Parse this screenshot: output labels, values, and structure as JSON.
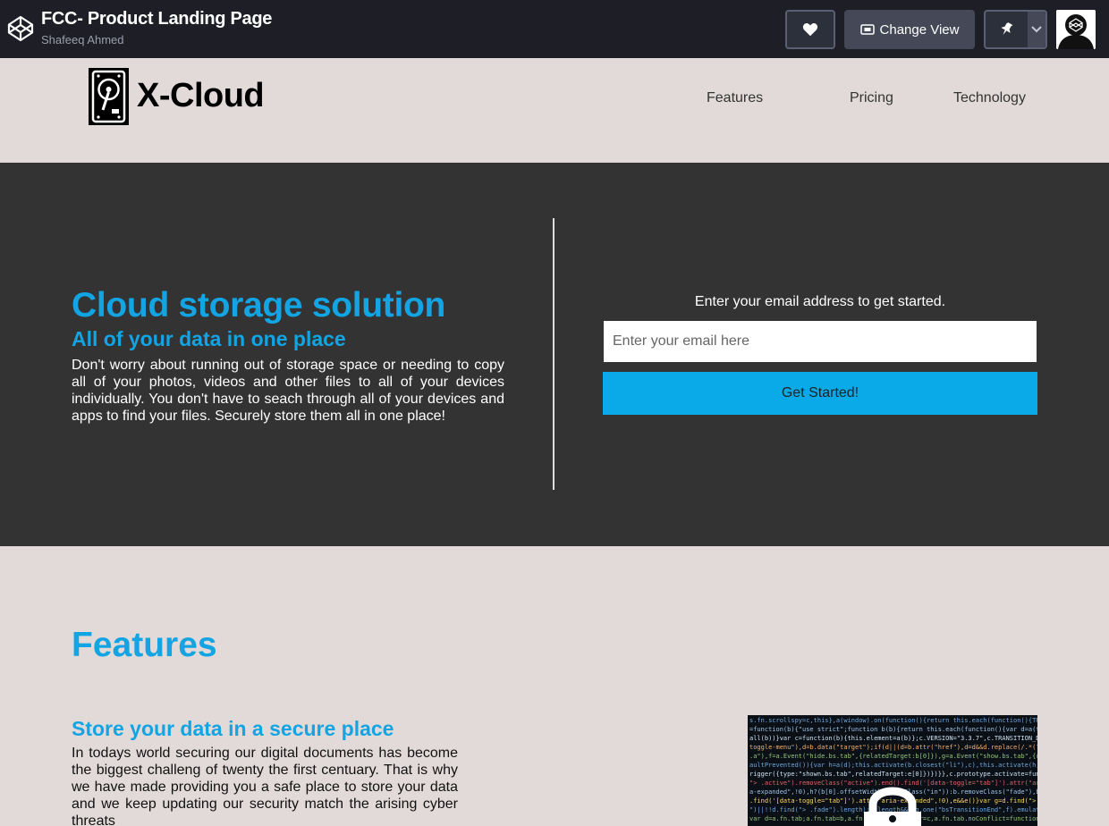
{
  "codepen": {
    "title": "FCC- Product Landing Page",
    "author": "Shafeeq Ahmed",
    "change_view_label": "Change View"
  },
  "site": {
    "brand": "X-Cloud",
    "nav": [
      {
        "label": "Features"
      },
      {
        "label": "Pricing"
      },
      {
        "label": "Technology"
      }
    ]
  },
  "hero": {
    "title": "Cloud storage solution",
    "subtitle": "All of your data in one place",
    "text": "Don't worry about running out of storage space or needing to copy all of your photos, videos and other files to all of your devices individually. You don't have to seach through all of your devices and apps to find your files. Securely store them all in one place!",
    "email_prompt": "Enter your email address to get started.",
    "email_placeholder": "Enter your email here",
    "submit_label": "Get Started!"
  },
  "features": {
    "heading": "Features",
    "items": [
      {
        "title": "Store your data in a secure place",
        "text": "In todays world securing our digital documents has become the biggest challeng of twenty the first centuary. That is why we have made providing you a safe place to store your data and we keep updating our security match the arising cyber threats"
      }
    ]
  },
  "colors": {
    "accent": "#12a4e3",
    "button": "#0aa9e8",
    "hero_bg": "#333333",
    "page_bg": "#e2dad9",
    "codepen_bar": "#1e1f26"
  }
}
